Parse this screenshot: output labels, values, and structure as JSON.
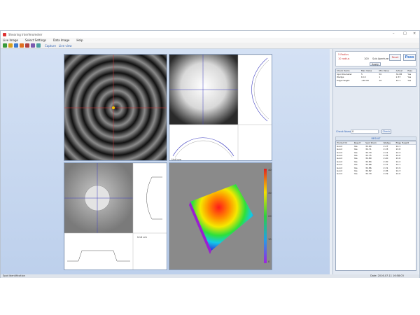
{
  "window": {
    "title": "Shearing Interferometer",
    "win_min": "–",
    "win_max": "□",
    "win_close": "×"
  },
  "menu": [
    "Live Image",
    "Select Settings",
    "Data Image",
    "Help"
  ],
  "toolbar": {
    "link1": "Capture",
    "link2": "Live view"
  },
  "controls": {
    "radio1": "5 Radius",
    "radio2": "10 radius",
    "sub_value": "100",
    "sub_label": "Sub Aperture",
    "reset_label": "Reset",
    "pass_label": "Pass",
    "apply_label": "Apply"
  },
  "info_table": {
    "headers": [
      "Check Items",
      "Max Value",
      "Min Value",
      "Actual",
      "Pass"
    ],
    "rows": [
      [
        "Spot Diameter",
        "5",
        "50",
        "32.88",
        "Yes"
      ],
      [
        "Wedge",
        "10.0",
        "1",
        "2.37",
        "Yes"
      ],
      [
        "Edge Height",
        "+30.00",
        "10",
        "14.1",
        "Yes"
      ]
    ]
  },
  "check": {
    "label": "Check Name",
    "value": "0",
    "button": "Check"
  },
  "results_title": "RESULT",
  "results_table": {
    "headers": [
      "Product Id",
      "Result",
      "Spot Diam",
      "Wedge",
      "Edge Height"
    ],
    "rows": [
      [
        "Good",
        "Yes",
        "32.64",
        "2.27",
        "14.1"
      ],
      [
        "Good",
        "Yes",
        "32.71",
        "2.33",
        "13.8"
      ],
      [
        "Good",
        "Yes",
        "32.70",
        "2.21",
        "14.4"
      ],
      [
        "Good",
        "Yes",
        "32.75",
        "2.35",
        "14.0"
      ],
      [
        "Good",
        "Yes",
        "32.80",
        "2.40",
        "13.6"
      ],
      [
        "Good",
        "Yes",
        "32.84",
        "2.30",
        "14.2"
      ],
      [
        "Good",
        "Yes",
        "32.88",
        "2.37",
        "14.1"
      ],
      [
        "Good",
        "Yes",
        "32.86",
        "2.31",
        "13.9"
      ],
      [
        "Good",
        "Yes",
        "32.82",
        "2.36",
        "14.3"
      ],
      [
        "Good",
        "Yes",
        "32.79",
        "2.29",
        "14.0"
      ]
    ]
  },
  "plots": {
    "label_a": "Unit um",
    "label_b": "Unit um",
    "label_c": "Unit um",
    "label_d": "Unit um"
  },
  "colorbar_ticks": [
    "400",
    "300",
    "200",
    "100",
    "0"
  ],
  "status": {
    "left": "Spot identification",
    "right": "Date: 2016-07-11 16:58:03"
  },
  "colors": {
    "accent": "#2b5fb4",
    "reset": "#c33",
    "pass": "#3b7ad0"
  }
}
